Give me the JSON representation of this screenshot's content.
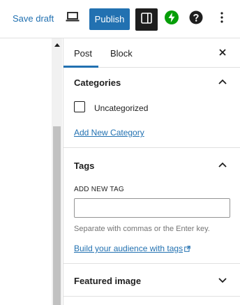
{
  "toolbar": {
    "save_draft_label": "Save draft",
    "publish_label": "Publish",
    "icons": {
      "preview": "laptop-icon",
      "settings": "sidebar-toggle-icon",
      "jetpack": "jetpack-bolt-icon",
      "help": "help-icon",
      "more": "more-vertical-icon"
    }
  },
  "sidebar": {
    "tabs": [
      {
        "label": "Post",
        "active": true
      },
      {
        "label": "Block",
        "active": false
      }
    ],
    "categories": {
      "title": "Categories",
      "items": [
        {
          "label": "Uncategorized",
          "checked": false
        }
      ],
      "add_link": "Add New Category"
    },
    "tags": {
      "title": "Tags",
      "input_label": "ADD NEW TAG",
      "input_value": "",
      "help_text": "Separate with commas or the Enter key.",
      "audience_link": "Build your audience with tags"
    },
    "featured_image": {
      "title": "Featured image"
    }
  },
  "colors": {
    "accent": "#2271b1",
    "dark": "#1e1e1e",
    "jetpack_green": "#069e08"
  }
}
